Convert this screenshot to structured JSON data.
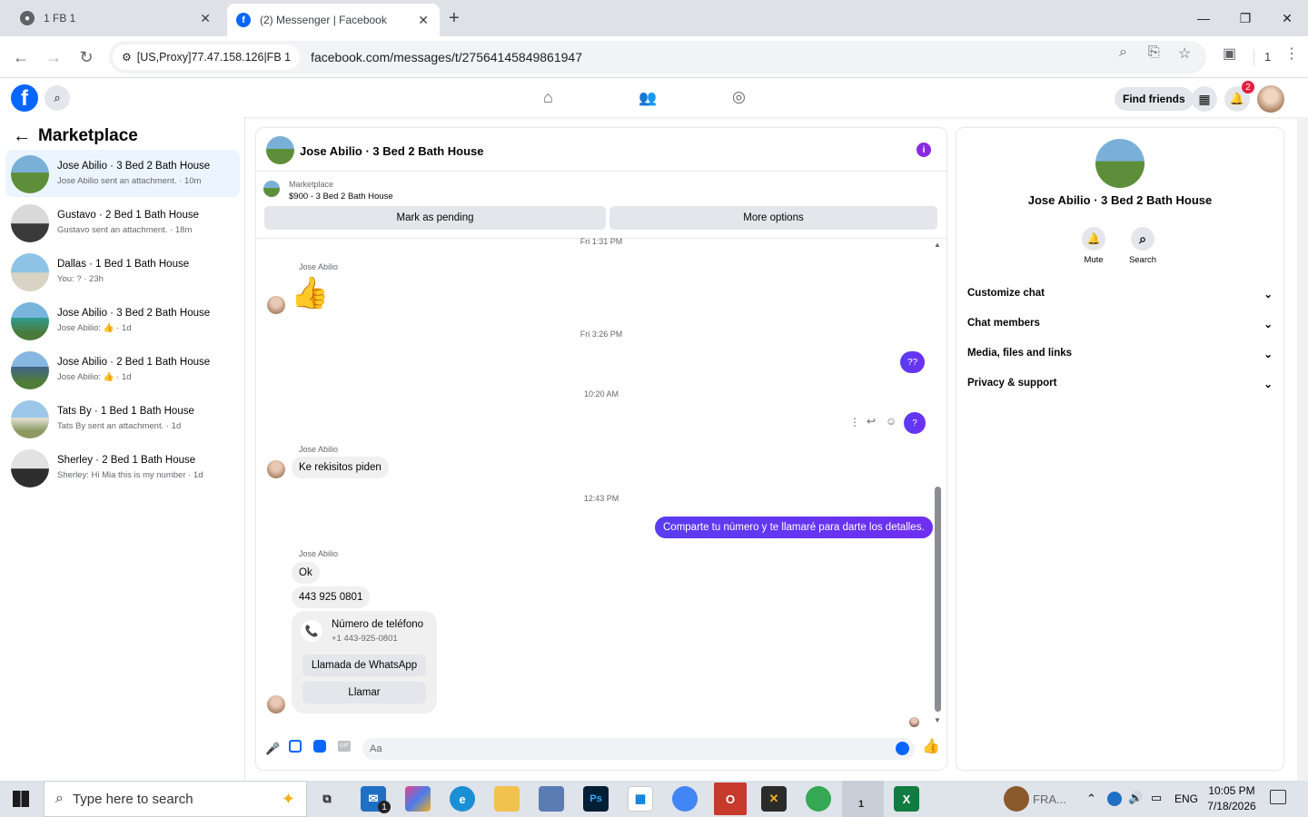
{
  "browser": {
    "tabs": [
      {
        "title": "1 FB 1"
      },
      {
        "title": "(2) Messenger | Facebook"
      }
    ],
    "new_tab": "+",
    "proxy_label": "[US,Proxy]77.47.158.126|FB 1",
    "url": "facebook.com/messages/t/27564145849861947",
    "profile_count": "1"
  },
  "fb": {
    "logo": "f",
    "find_friends": "Find friends",
    "notif_count": "2"
  },
  "sidebar": {
    "title": "Marketplace",
    "conversations": [
      {
        "name": "Jose Abilio · 3 Bed 2 Bath House",
        "preview": "Jose Abilio sent an attachment. · 10m"
      },
      {
        "name": "Gustavo · 2 Bed 1 Bath House",
        "preview": "Gustavo sent an attachment. · 18m"
      },
      {
        "name": "Dallas · 1 Bed 1 Bath House",
        "preview": "You: ? · 23h"
      },
      {
        "name": "Jose Abilio · 3 Bed 2 Bath House",
        "preview": "Jose Abilio: 👍 · 1d"
      },
      {
        "name": "Jose Abilio · 2 Bed 1 Bath House",
        "preview": "Jose Abilio: 👍 · 1d"
      },
      {
        "name": "Tats By · 1 Bed 1 Bath House",
        "preview": "Tats By sent an attachment. · 1d"
      },
      {
        "name": "Sherley · 2 Bed 1 Bath House",
        "preview": "Sherley: Hi Mia this is my number · 1d"
      }
    ]
  },
  "chat": {
    "title": "Jose Abilio · 3 Bed 2 Bath House",
    "info_icon": "i",
    "marketplace_label": "Marketplace",
    "listing": "$900 - 3 Bed 2 Bath House",
    "mark_pending": "Mark as pending",
    "more_options": "More options",
    "messages": {
      "ts0": "Fri 1:31 PM",
      "sender1": "Jose Abilio",
      "ts1": "Fri 3:26 PM",
      "out1": "??",
      "ts2": "10:20 AM",
      "out2": "?",
      "sender2": "Jose Abilio",
      "in2": "Ke rekisitos piden",
      "ts3": "12:43 PM",
      "out3": "Comparte tu número y te llamaré para darte los detalles.",
      "sender3": "Jose Abilio",
      "in3a": "Ok",
      "in3b": "443 925 0801",
      "card_title": "Número de teléfono",
      "card_number": "+1 443-925-0801",
      "card_btn1": "Llamada de WhatsApp",
      "card_btn2": "Llamar"
    },
    "input_placeholder": "Aa",
    "gif_label": "GIF"
  },
  "right": {
    "name": "Jose Abilio · 3 Bed 2 Bath House",
    "mute": "Mute",
    "search": "Search",
    "rows": [
      "Customize chat",
      "Chat members",
      "Media, files and links",
      "Privacy & support"
    ]
  },
  "taskbar": {
    "search_placeholder": "Type here to search",
    "tray_app": "FRA...",
    "lang": "ENG",
    "time": "10:05 PM",
    "date": "7/18/2026",
    "mail_badge": "1",
    "app_badge": "1"
  }
}
